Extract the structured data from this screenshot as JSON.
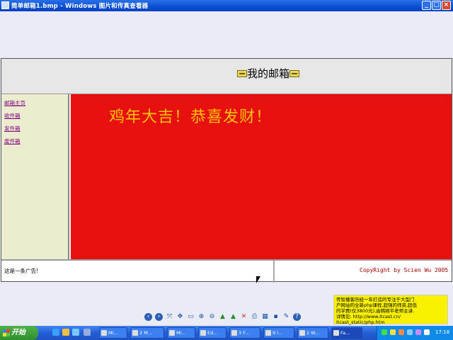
{
  "window": {
    "title": "简单邮箱1.bmp - Windows 图片和传真查看器",
    "minimize_glyph": "_",
    "maximize_glyph": "□",
    "close_glyph": "×"
  },
  "image": {
    "header_title": "我的邮箱",
    "sidebar_links": [
      "邮箱主页",
      "收件箱",
      "发件箱",
      "废件箱"
    ],
    "banner": "鸡年大吉！恭喜发财！",
    "ad_text": "这是一条广告!",
    "copyright": "CopyRight by Scien Wu 2005"
  },
  "toolbar": {
    "icons": [
      "previous-image-icon",
      "next-image-icon",
      "best-fit-icon",
      "actual-size-icon",
      "slideshow-icon",
      "zoom-in-icon",
      "zoom-out-icon",
      "rotate-clockwise-icon",
      "rotate-counterclockwise-icon",
      "delete-icon",
      "print-icon",
      "copy-to-icon",
      "save-icon",
      "edit-icon",
      "help-icon"
    ]
  },
  "ad_overlay": {
    "lines": [
      "传智播客历经一年打造的专注于大型门",
      "户网站的全新php课程,超强的师资,超低",
      "的学费(仅3800元),由韩顺平老师主讲.",
      "详情见: http://www.itcast.cn/",
      "itcast_static/php.htm"
    ]
  },
  "taskbar": {
    "start_label": "开始",
    "tasks": [
      "Mi...",
      "2 M...",
      "Mi...",
      "Ed...",
      "3 F...",
      "9 I...",
      "2 W...",
      "Fa..."
    ],
    "clock": "17:18"
  },
  "colors": {
    "content_bg": "#e80f0f",
    "banner_text": "#f7c400",
    "sidebar_bg": "#ececcf",
    "ad_bg": "#f9f000"
  }
}
